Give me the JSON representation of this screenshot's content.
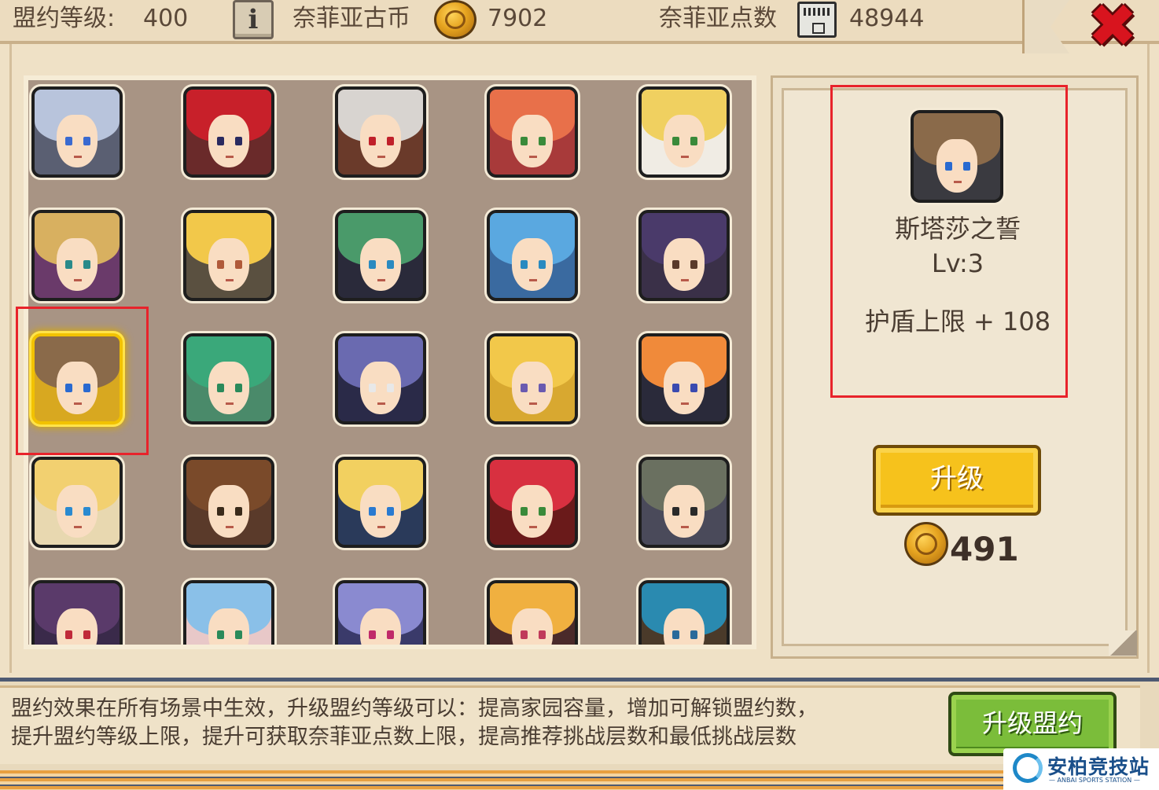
{
  "header": {
    "union_level_label": "盟约等级:",
    "union_level_value": "400",
    "info_label": "i",
    "coin_label": "奈菲亚古币",
    "coin_value": "7902",
    "points_label": "奈菲亚点数",
    "points_value": "48944",
    "close_label": "✖"
  },
  "heroes": [
    {
      "hair": "#b8c4dc",
      "eye": "#3a6ad0",
      "bg": "#5a5f72"
    },
    {
      "hair": "#c8202a",
      "eye": "#2a2a60",
      "bg": "#6a2a2a"
    },
    {
      "hair": "#d8d4d0",
      "eye": "#c0202a",
      "bg": "#6a3a2a"
    },
    {
      "hair": "#e8704a",
      "eye": "#3a8a3a",
      "bg": "#a83a3a"
    },
    {
      "hair": "#f0d060",
      "eye": "#3a8a3a",
      "bg": "#f0ece4"
    },
    {
      "hair": "#d8b060",
      "eye": "#2a8a8a",
      "bg": "#6a3a6a"
    },
    {
      "hair": "#f2c84a",
      "eye": "#b05a3a",
      "bg": "#5a5040"
    },
    {
      "hair": "#4a9a6a",
      "eye": "#2a8ac0",
      "bg": "#2a2a3a"
    },
    {
      "hair": "#5aa8e0",
      "eye": "#2a8ac0",
      "bg": "#3a6aa0"
    },
    {
      "hair": "#4a3a6a",
      "eye": "#5a3a2a",
      "bg": "#3a3048"
    },
    {
      "hair": "#8a6a4a",
      "eye": "#2a6ad0",
      "bg": "#d8a820"
    },
    {
      "hair": "#3aa87a",
      "eye": "#2a8a5a",
      "bg": "#4a8a6a"
    },
    {
      "hair": "#6a6ab0",
      "eye": "#e8e8e8",
      "bg": "#2a2a48"
    },
    {
      "hair": "#f2c84a",
      "eye": "#6a5ab0",
      "bg": "#d8a830"
    },
    {
      "hair": "#f08a3a",
      "eye": "#3a4ab0",
      "bg": "#2a2a3a"
    },
    {
      "hair": "#f2d070",
      "eye": "#2a8ad0",
      "bg": "#e8d8b0"
    },
    {
      "hair": "#7a4a2a",
      "eye": "#3a2a1a",
      "bg": "#5a3a2a"
    },
    {
      "hair": "#f2d060",
      "eye": "#2a7ad0",
      "bg": "#2a3a5a"
    },
    {
      "hair": "#d83040",
      "eye": "#3a8a3a",
      "bg": "#6a1a1a"
    },
    {
      "hair": "#6a7060",
      "eye": "#2a2a2a",
      "bg": "#4a4a5a"
    },
    {
      "hair": "#5a3a6a",
      "eye": "#c02a3a",
      "bg": "#3a2a4a"
    },
    {
      "hair": "#8ac0e8",
      "eye": "#2a8a5a",
      "bg": "#e8c8c8"
    },
    {
      "hair": "#8a8ad0",
      "eye": "#c02a6a",
      "bg": "#3a3a6a"
    },
    {
      "hair": "#f0b040",
      "eye": "#c03a5a",
      "bg": "#4a2a2a"
    },
    {
      "hair": "#2a8ab0",
      "eye": "#2a6a9a",
      "bg": "#4a3a2a"
    }
  ],
  "selected_index": 10,
  "detail": {
    "portrait": {
      "hair": "#8a6a4a",
      "eye": "#2a6ad0",
      "bg": "#3a3a40"
    },
    "name": "斯塔莎之誓",
    "level": "Lv:3",
    "effect": "护盾上限 + 108",
    "upgrade_label": "升级",
    "cost_value": "491"
  },
  "footer": {
    "description_line1": "盟约效果在所有场景中生效，升级盟约等级可以：提高家园容量，增加可解锁盟约数，",
    "description_line2": "提升盟约等级上限，提升可获取奈菲亚点数上限，提高推荐挑战层数和最低挑战层数",
    "upgrade_union_label": "升级盟约"
  },
  "watermark": {
    "name": "安柏竞技站",
    "sub": "— ANBAI SPORTS STATION —"
  }
}
